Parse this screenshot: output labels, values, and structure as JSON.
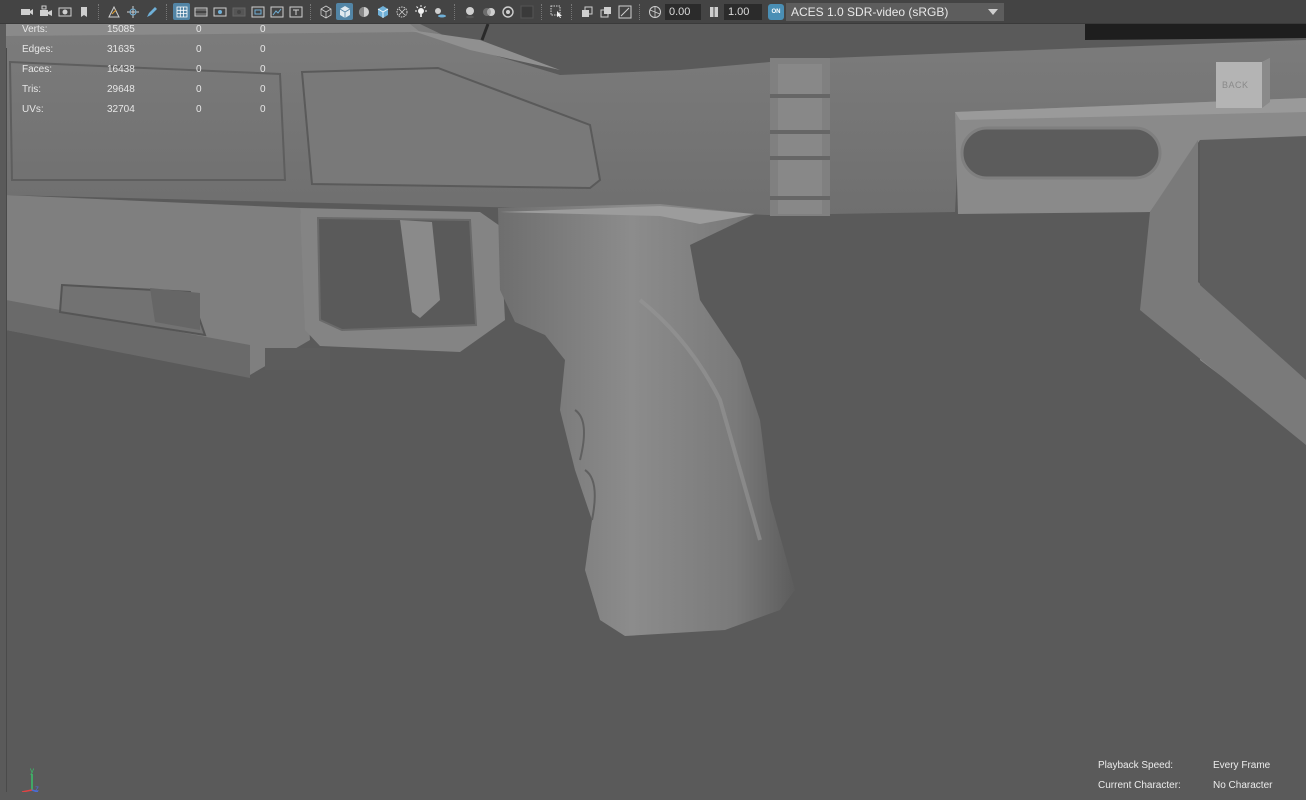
{
  "toolbar": {
    "exposure_value": "0.00",
    "gamma_value": "1.00",
    "on_label": "ON",
    "view_transform": "ACES 1.0 SDR-video (sRGB)",
    "accent_color": "#5285a6"
  },
  "hud_stats": [
    {
      "label": "Verts:",
      "v1": "15085",
      "v2": "0",
      "v3": "0"
    },
    {
      "label": "Edges:",
      "v1": "31635",
      "v2": "0",
      "v3": "0"
    },
    {
      "label": "Faces:",
      "v1": "16438",
      "v2": "0",
      "v3": "0"
    },
    {
      "label": "Tris:",
      "v1": "29648",
      "v2": "0",
      "v3": "0"
    },
    {
      "label": "UVs:",
      "v1": "32704",
      "v2": "0",
      "v3": "0"
    }
  ],
  "viewcube": {
    "label": "BACK"
  },
  "bottom_info": {
    "playback_label": "Playback Speed:",
    "playback_value": "Every Frame",
    "character_label": "Current Character:",
    "character_value": "No Character"
  },
  "axis": {
    "y_label": "y",
    "z_label": "z"
  }
}
